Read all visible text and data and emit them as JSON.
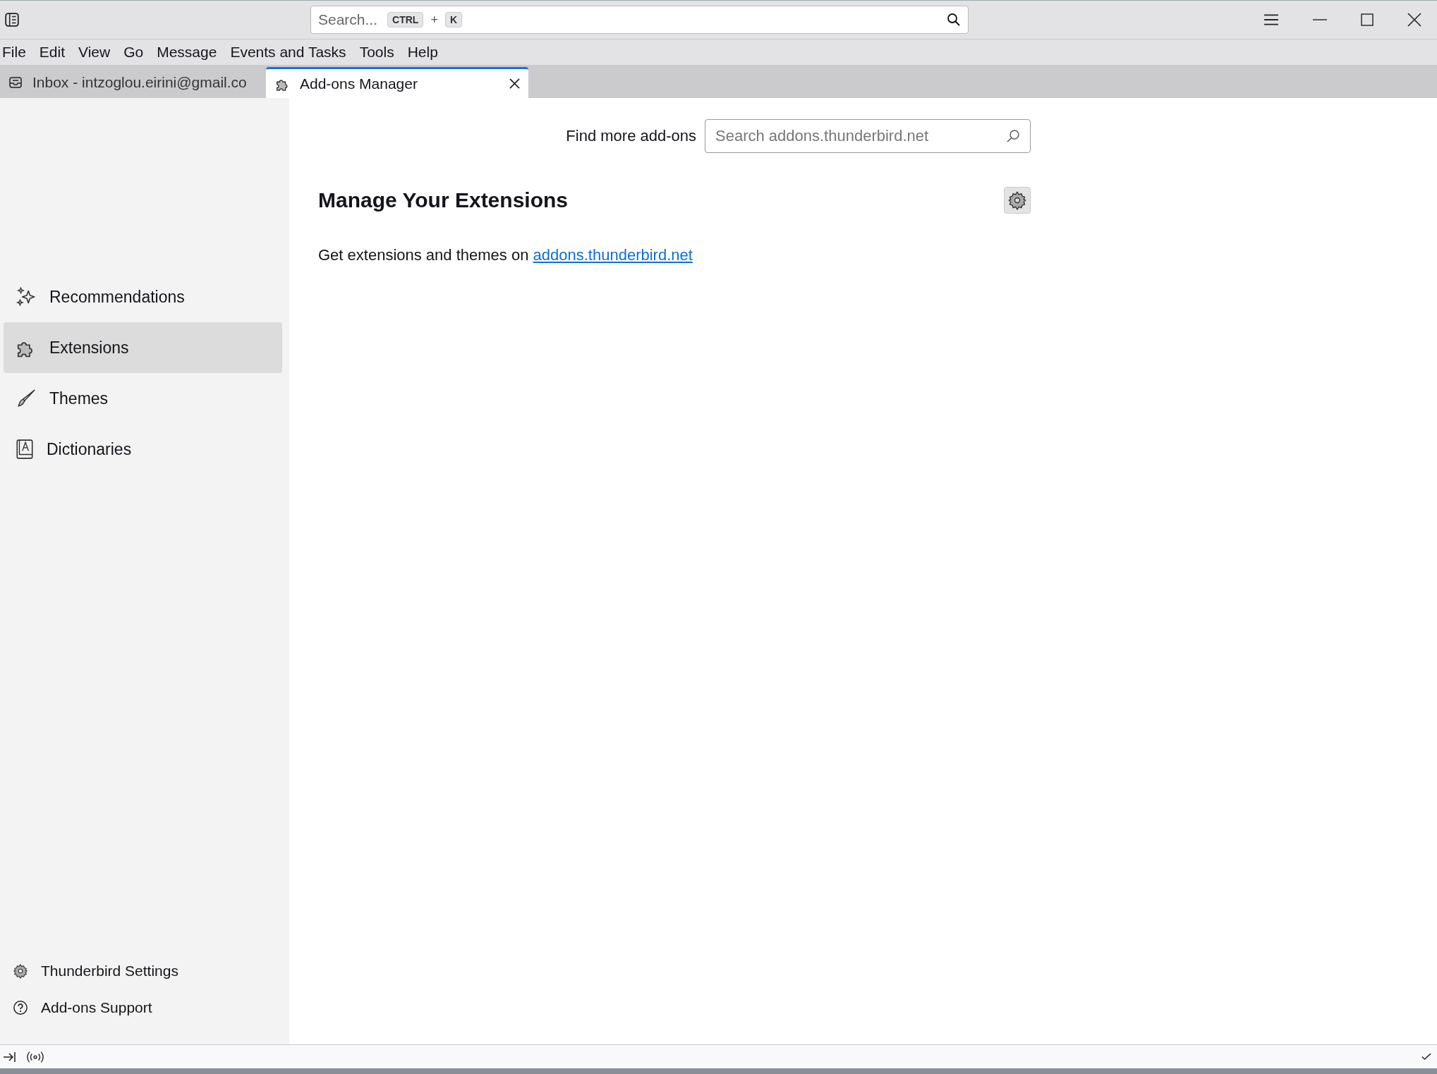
{
  "title_bar": {
    "search": {
      "placeholder": "Search...",
      "shortcut": [
        "CTRL",
        "K"
      ],
      "joiner": "+"
    }
  },
  "menu_bar": [
    "File",
    "Edit",
    "View",
    "Go",
    "Message",
    "Events and Tasks",
    "Tools",
    "Help"
  ],
  "tabs": [
    {
      "label": "Inbox - intzoglou.eirini@gmail.co",
      "kind": "mail",
      "selected": false
    },
    {
      "label": "Add-ons Manager",
      "kind": "addons",
      "selected": true
    }
  ],
  "sidebar": {
    "items": [
      {
        "label": "Recommendations",
        "kind": "sparkle",
        "selected": false
      },
      {
        "label": "Extensions",
        "kind": "puzzle",
        "selected": true
      },
      {
        "label": "Themes",
        "kind": "brush",
        "selected": false
      },
      {
        "label": "Dictionaries",
        "kind": "book",
        "selected": false
      }
    ],
    "footer": [
      {
        "label": "Thunderbird Settings",
        "kind": "gear"
      },
      {
        "label": "Add-ons Support",
        "kind": "help"
      }
    ]
  },
  "main": {
    "find_label": "Find more add-ons",
    "find_placeholder": "Search addons.thunderbird.net",
    "heading": "Manage Your Extensions",
    "intro": "Get extensions and themes on",
    "intro_link": "addons.thunderbird.net"
  }
}
